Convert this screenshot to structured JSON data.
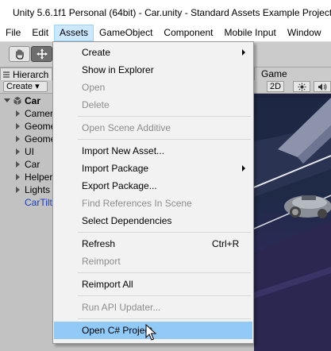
{
  "window": {
    "title": "Unity 5.6.1f1 Personal (64bit) - Car.unity - Standard Assets Example Project",
    "app_icon": "unity-logo-icon"
  },
  "menubar": [
    "File",
    "Edit",
    "Assets",
    "GameObject",
    "Component",
    "Mobile Input",
    "Window"
  ],
  "menubar_active": "Assets",
  "toolbar": {
    "tools": [
      "hand-tool-icon",
      "move-tool-icon"
    ]
  },
  "hierarchy": {
    "tab_label": "Hierarch",
    "create_label": "Create ▾",
    "root": "Car",
    "items": [
      {
        "label": "Camer",
        "expandable": true
      },
      {
        "label": "Geome",
        "expandable": true
      },
      {
        "label": "Geome",
        "expandable": true
      },
      {
        "label": "UI",
        "expandable": true
      },
      {
        "label": "Car",
        "expandable": true
      },
      {
        "label": "Helper",
        "expandable": true
      },
      {
        "label": "Lights",
        "expandable": true
      },
      {
        "label": "CarTilt",
        "expandable": false,
        "prefab": true
      }
    ]
  },
  "scene": {
    "tab_label": "Game",
    "btn_2d": "2D",
    "sun_icon": "sun-icon",
    "audio_icon": "speaker-icon"
  },
  "assets_menu": [
    {
      "label": "Create",
      "submenu": true,
      "enabled": true
    },
    {
      "label": "Show in Explorer",
      "enabled": true
    },
    {
      "label": "Open",
      "enabled": false
    },
    {
      "label": "Delete",
      "enabled": false
    },
    {
      "separator": true
    },
    {
      "label": "Open Scene Additive",
      "enabled": false
    },
    {
      "separator": true
    },
    {
      "label": "Import New Asset...",
      "enabled": true
    },
    {
      "label": "Import Package",
      "submenu": true,
      "enabled": true
    },
    {
      "label": "Export Package...",
      "enabled": true
    },
    {
      "label": "Find References In Scene",
      "enabled": false
    },
    {
      "label": "Select Dependencies",
      "enabled": true
    },
    {
      "separator": true
    },
    {
      "label": "Refresh",
      "shortcut": "Ctrl+R",
      "enabled": true
    },
    {
      "label": "Reimport",
      "enabled": false
    },
    {
      "separator": true
    },
    {
      "label": "Reimport All",
      "enabled": true
    },
    {
      "separator": true
    },
    {
      "label": "Run API Updater...",
      "enabled": false
    },
    {
      "separator": true
    },
    {
      "label": "Open C# Project",
      "enabled": true,
      "highlighted": true
    }
  ],
  "colors": {
    "menu_highlight": "#91c9f7",
    "menubar_active": "#cce8ff",
    "disabled_text": "#8d8d8d",
    "prefab_text": "#1b3eb8"
  }
}
